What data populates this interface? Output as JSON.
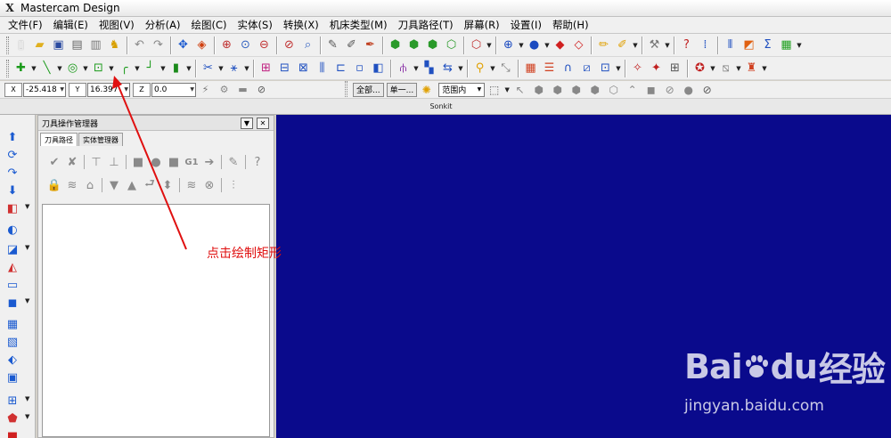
{
  "window": {
    "title": "Mastercam Design"
  },
  "menu": [
    {
      "label": "文件(F)"
    },
    {
      "label": "编辑(E)"
    },
    {
      "label": "视图(V)"
    },
    {
      "label": "分析(A)"
    },
    {
      "label": "绘图(C)"
    },
    {
      "label": "实体(S)"
    },
    {
      "label": "转换(X)"
    },
    {
      "label": "机床类型(M)"
    },
    {
      "label": "刀具路径(T)"
    },
    {
      "label": "屏幕(R)"
    },
    {
      "label": "设置(I)"
    },
    {
      "label": "帮助(H)"
    }
  ],
  "coords": {
    "x_value": "-25.418",
    "y_value": "16.397",
    "z_value": "0.0",
    "btn_all": "全部...",
    "btn_single": "单一...",
    "scope_select": "范围内"
  },
  "sonkit_label": "Sonkit",
  "ops_manager": {
    "title": "刀具操作管理器",
    "tab_toolpaths": "刀具路径",
    "tab_solids": "实体管理器",
    "gcode_label": "G1"
  },
  "annotation": {
    "text": "点击绘制矩形",
    "color": "#e01010"
  },
  "watermark": {
    "logo_text_1": "Bai",
    "logo_text_2": "du",
    "logo_text_3": "经验",
    "url": "jingyan.baidu.com"
  },
  "colors": {
    "viewport_bg": "#0a0a8c",
    "annotation": "#e01010"
  }
}
